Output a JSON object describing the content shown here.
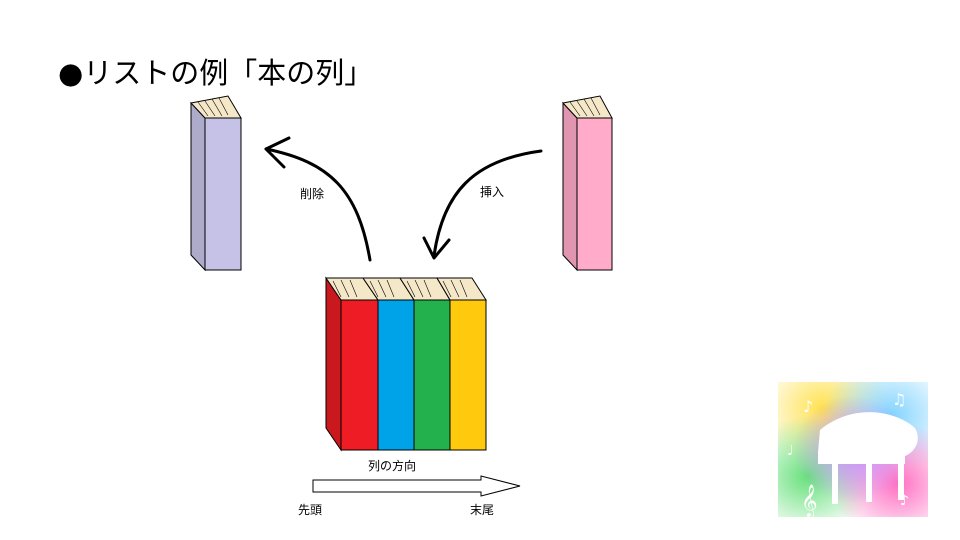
{
  "title": "●リストの例「本の列」",
  "labels": {
    "delete": "削除",
    "insert": "挿入",
    "direction": "列の方向",
    "head": "先頭",
    "tail": "末尾"
  },
  "books": {
    "removed": {
      "color": "#c6c1e6"
    },
    "inserted": {
      "color": "#ffabc9"
    },
    "row": [
      {
        "name": "red",
        "color": "#ee1c24"
      },
      {
        "name": "blue",
        "color": "#00a2e8"
      },
      {
        "name": "green",
        "color": "#22b14c"
      },
      {
        "name": "yellow",
        "color": "#ffc90e"
      }
    ]
  },
  "page_edge_color": "#f5e8c8",
  "decoration": {
    "icon": "grand-piano-music-notes-icon"
  }
}
